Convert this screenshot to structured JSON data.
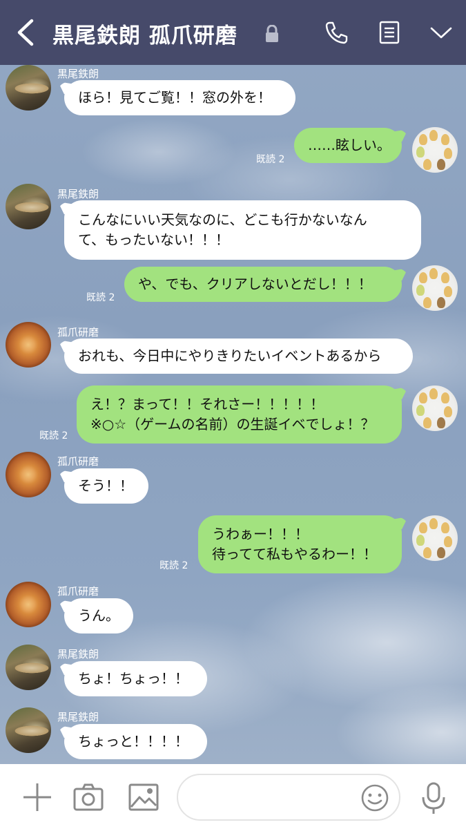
{
  "header": {
    "title": "黒尾鉄朗  孤爪研磨",
    "icons": [
      "back-icon",
      "lock-icon",
      "phone-icon",
      "notes-icon",
      "chevron-down-icon"
    ],
    "bg_color": "#464a6a"
  },
  "messages": [
    {
      "from": "kuroo",
      "name": "黒尾鉄朗",
      "lines": [
        "ほら！見てご覧！！窓の外を！"
      ]
    },
    {
      "from": "self",
      "read": "既読 2",
      "lines": [
        "……眩しい。"
      ]
    },
    {
      "from": "kuroo",
      "name": "黒尾鉄朗",
      "lines": [
        "こんなにいい天気なのに、どこも行かないなん",
        "て、もったいない！！！"
      ]
    },
    {
      "from": "self",
      "read": "既読 2",
      "lines": [
        "や、でも、クリアしないとだし！！！"
      ]
    },
    {
      "from": "kenma",
      "name": "孤爪研磨",
      "lines": [
        "おれも、今日中にやりきりたいイベントあるから"
      ]
    },
    {
      "from": "self",
      "read": "既読 2",
      "lines": [
        "え！？まって！！それさー！！！！！",
        "※○☆（ゲームの名前）の生誕イベでしょ！？"
      ]
    },
    {
      "from": "kenma",
      "name": "孤爪研磨",
      "lines": [
        "そう！！"
      ]
    },
    {
      "from": "self",
      "read": "既読 2",
      "lines": [
        "うわぁー！！！",
        "待ってて私もやるわー！！"
      ]
    },
    {
      "from": "kenma",
      "name": "孤爪研磨",
      "lines": [
        "うん。"
      ]
    },
    {
      "from": "kuroo",
      "name": "黒尾鉄朗",
      "lines": [
        "ちょ！ちょっ！！"
      ]
    },
    {
      "from": "kuroo",
      "name": "黒尾鉄朗",
      "lines": [
        "ちょっと！！！！"
      ]
    }
  ],
  "input_bar": {
    "input_value": "",
    "icons": [
      "plus-icon",
      "camera-icon",
      "image-icon",
      "emoji-icon",
      "mic-icon"
    ]
  },
  "colors": {
    "incoming_bubble": "#ffffff",
    "outgoing_bubble": "#a2e27f",
    "chat_bg": "#8fa6c4"
  }
}
